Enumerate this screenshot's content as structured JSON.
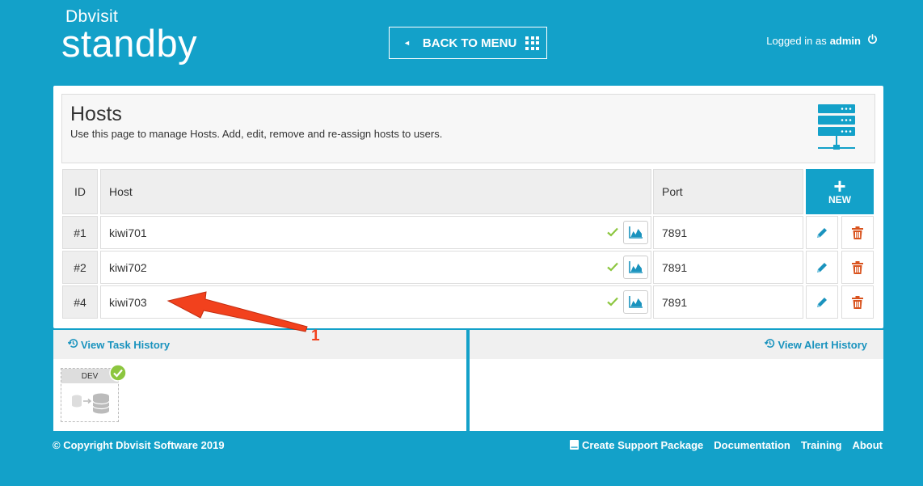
{
  "logo": {
    "brand": "Dbvisit",
    "product": "standby"
  },
  "header": {
    "back_label": "BACK TO MENU",
    "login_prefix": "Logged in as",
    "login_user": "admin"
  },
  "page": {
    "title": "Hosts",
    "description": "Use this page to manage Hosts. Add, edit, remove and re-assign hosts to users."
  },
  "table": {
    "headers": {
      "id": "ID",
      "host": "Host",
      "port": "Port"
    },
    "new_label": "NEW",
    "rows": [
      {
        "id": "#1",
        "host": "kiwi701",
        "port": "7891"
      },
      {
        "id": "#2",
        "host": "kiwi702",
        "port": "7891"
      },
      {
        "id": "#4",
        "host": "kiwi703",
        "port": "7891"
      }
    ]
  },
  "task_history": {
    "label": "View Task History",
    "env_label": "DEV"
  },
  "alert_history": {
    "label": "View Alert History"
  },
  "footer": {
    "copyright": "© Copyright Dbvisit Software 2019",
    "links": [
      "Create Support Package",
      "Documentation",
      "Training",
      "About"
    ]
  },
  "annotation": {
    "label": "1"
  },
  "colors": {
    "brand": "#13a1c9",
    "check": "#8cc63f",
    "edit": "#1a93be",
    "delete": "#d9531e",
    "annotation": "#f2411d"
  }
}
